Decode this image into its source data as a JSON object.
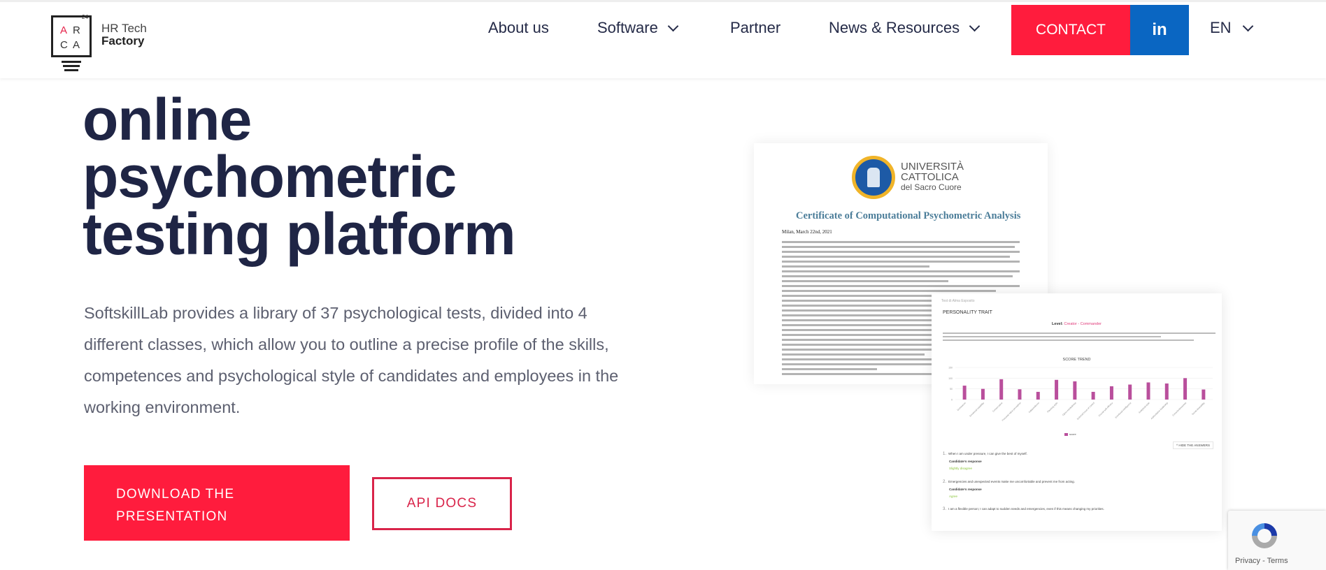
{
  "header": {
    "logo": {
      "letters": [
        "A",
        "R",
        "C",
        "A"
      ],
      "superscript": "24",
      "line1": "HR Tech",
      "line2": "Factory",
      "accent_color": "#e5234a"
    },
    "nav": [
      {
        "label": "About us",
        "has_dropdown": false
      },
      {
        "label": "Software",
        "has_dropdown": true
      },
      {
        "label": "Partner",
        "has_dropdown": false
      },
      {
        "label": "News & Resources",
        "has_dropdown": true
      }
    ],
    "contact_label": "CONTACT",
    "linkedin_label": "in",
    "language": "EN",
    "colors": {
      "contact": "#ff1c3d",
      "linkedin": "#0a66c2"
    }
  },
  "hero": {
    "title_lines": [
      "online",
      "psychometric",
      "testing platform"
    ],
    "description": "SoftskillLab provides a library of 37 psychological tests, divided into 4 different classes, which allow you to outline a precise profile of the skills, competences and psychological style of candidates and employees in the working environment.",
    "download_label_line1": "DOWNLOAD THE",
    "download_label_line2": "PRESENTATION",
    "api_docs_label": "API DOCS",
    "accent_color": "#ff1c3d"
  },
  "certificate": {
    "university_line1": "UNIVERSITÀ",
    "university_line2": "CATTOLICA",
    "university_line3": "del Sacro Cuore",
    "title": "Certificate of Computational Psychometric Analysis",
    "date": "Milan, March 22nd, 2021"
  },
  "report": {
    "back_link": "Test di Alma Esposito",
    "section_title": "PERSONALITY TRAIT",
    "level_label": "Level:",
    "level_value": "Creator - Commander",
    "chart_title": "SCORE TREND",
    "legend_label": "score",
    "hide_answers_label": "^ HIDE THE ANSWERS",
    "questions": [
      {
        "number": "1.",
        "text": "When I am under pressure, I can give the best of myself.",
        "response_label": "Candidate's response",
        "response": "Slightly disagree"
      },
      {
        "number": "2.",
        "text": "Emergencies and unexpected events make me uncomfortable and prevent me from acting.",
        "response_label": "Candidate's response",
        "response": "Agree"
      },
      {
        "number": "3.",
        "text": "I am a flexible person; I can adapt to sudden needs and emergencies, even if this means changing my priorities.",
        "response_label": "",
        "response": ""
      }
    ]
  },
  "chart_data": {
    "type": "bar",
    "title": "SCORE TREND",
    "categories": [
      "Dominance",
      "Emotional instability",
      "Conservative",
      "Personal value perception",
      "Independence",
      "Planning style",
      "Open-mindedness",
      "External locus of control",
      "Crucial self-efficacy",
      "Emotional intelligence",
      "Analytical style",
      "Authoritative leadership",
      "Conscientiousness",
      "Social desirability"
    ],
    "series": [
      {
        "name": "score",
        "values": [
          65,
          50,
          95,
          48,
          36,
          92,
          85,
          36,
          62,
          70,
          80,
          75,
          100,
          47
        ],
        "color": "#b94f9c"
      }
    ],
    "yticks": [
      0,
      50,
      100,
      150
    ],
    "ylim": [
      0,
      150
    ],
    "legend": "bottom-center",
    "grid": true
  },
  "recaptcha": {
    "privacy_label": "Privacy",
    "separator": " - ",
    "terms_label": "Terms"
  }
}
